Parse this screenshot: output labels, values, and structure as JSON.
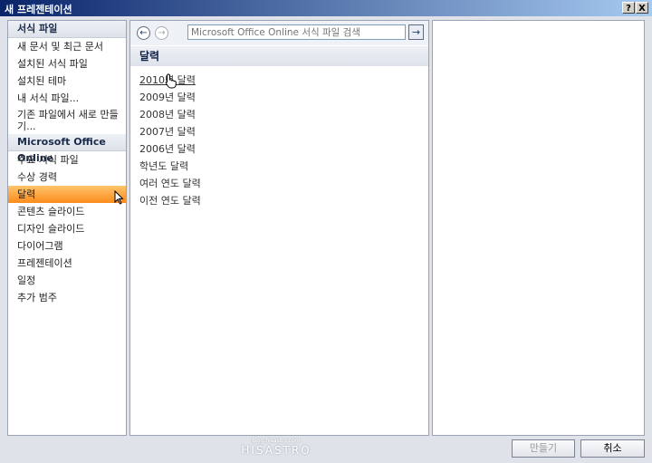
{
  "window": {
    "title": "새 프레젠테이션",
    "help_btn": "?",
    "close_btn": "X"
  },
  "sidebar": {
    "section_templates": "서식 파일",
    "items_templates": [
      {
        "label": "새 문서 및 최근 문서"
      },
      {
        "label": "설치된 서식 파일"
      },
      {
        "label": "설치된 테마"
      },
      {
        "label": "내 서식 파일..."
      },
      {
        "label": "기존 파일에서 새로 만들기..."
      }
    ],
    "section_online": "Microsoft Office Online",
    "items_online": [
      {
        "label": "주요 서식 파일"
      },
      {
        "label": "수상 경력"
      },
      {
        "label": "달력",
        "selected": true
      },
      {
        "label": "콘텐츠 슬라이드"
      },
      {
        "label": "디자인 슬라이드"
      },
      {
        "label": "다이어그램"
      },
      {
        "label": "프레젠테이션"
      },
      {
        "label": "일정"
      },
      {
        "label": "추가 범주"
      }
    ]
  },
  "search": {
    "placeholder": "Microsoft Office Online 서식 파일 검색",
    "back_icon": "back-arrow-icon",
    "forward_icon": "forward-arrow-icon",
    "go_icon": "go-arrow-icon"
  },
  "main": {
    "heading": "달력",
    "links": [
      {
        "label": "2010년 달력",
        "hover": true
      },
      {
        "label": "2009년 달력"
      },
      {
        "label": "2008년 달력"
      },
      {
        "label": "2007년 달력"
      },
      {
        "label": "2006년 달력"
      },
      {
        "label": "학년도 달력"
      },
      {
        "label": "여러 연도 달력"
      },
      {
        "label": "이전 연도 달력"
      }
    ]
  },
  "footer": {
    "create_label": "만들기",
    "cancel_label": "취소"
  },
  "watermark": {
    "small": "blog.hisastro.com",
    "big": "HISASTRO"
  },
  "colors": {
    "selected_gradient_top": "#ffc56a",
    "selected_gradient_bottom": "#fb8b1d",
    "titlebar_start": "#0a246a",
    "titlebar_end": "#a6caf0"
  }
}
